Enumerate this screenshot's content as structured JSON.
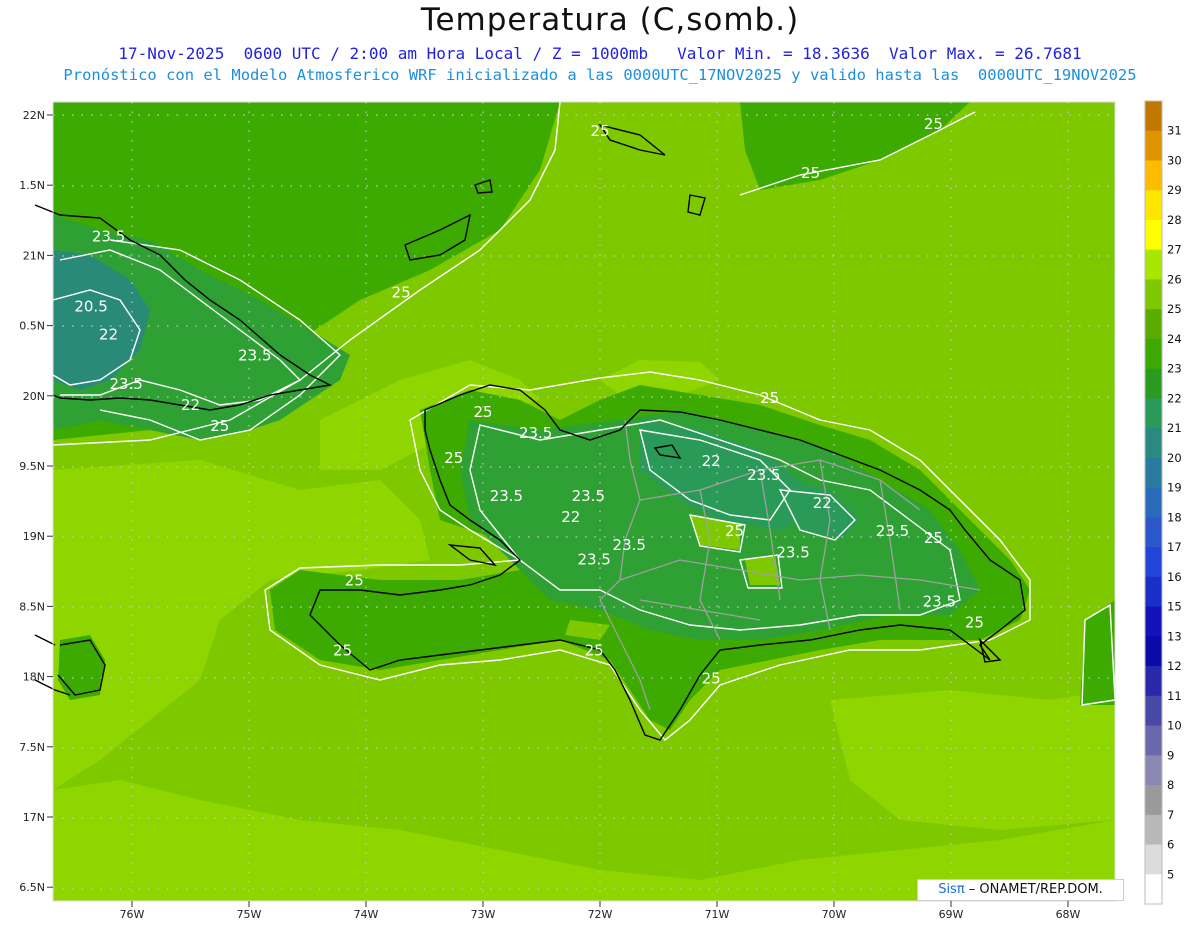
{
  "title": "Temperatura (C,somb.)",
  "subtitle_line1": "17-Nov-2025  0600 UTC / 2:00 am Hora Local / Z = 1000mb   Valor Min. = 18.3636  Valor Max. = 26.7681",
  "subtitle_line2": "Pronóstico con el Modelo Atmosferico WRF inicializado a las 0000UTC_17NOV2025 y valido hasta las  0000UTC_19NOV2025",
  "credit": {
    "brand": "Sisπ",
    "text": " – ONAMET/REP.DOM."
  },
  "axes": {
    "lat_ticks": [
      "22N",
      "1.5N",
      "21N",
      "0.5N",
      "20N",
      "9.5N",
      "19N",
      "8.5N",
      "18N",
      "7.5N",
      "17N",
      "6.5N"
    ],
    "lon_ticks": [
      "76W",
      "75W",
      "74W",
      "73W",
      "72W",
      "71W",
      "70W",
      "69W",
      "68W"
    ]
  },
  "colorbar": {
    "labels": [
      "31",
      "30",
      "29",
      "28",
      "27",
      "26",
      "25",
      "24",
      "23",
      "22",
      "21",
      "20",
      "19",
      "18",
      "17",
      "16",
      "15",
      "13",
      "12",
      "11",
      "10",
      "9",
      "8",
      "7",
      "6",
      "5"
    ],
    "colors": [
      "#c07800",
      "#e09400",
      "#ffbb00",
      "#ffe600",
      "#ffff00",
      "#a8e600",
      "#7dc800",
      "#5aac00",
      "#3ca800",
      "#2a9a20",
      "#2a9a58",
      "#2a8a80",
      "#2a7aa0",
      "#2a6ab8",
      "#2a58cc",
      "#2244d8",
      "#1a2ec8",
      "#1212b8",
      "#0a0aa8",
      "#2828a8",
      "#4848a8",
      "#6868aa",
      "#8a88b0",
      "#9a9a9a",
      "#b8b8b8",
      "#dcdcdc",
      "#ffffff"
    ]
  },
  "contour_labels": [
    {
      "t": "25",
      "lon": -72.0,
      "lat": 21.85
    },
    {
      "t": "25",
      "lon": -69.15,
      "lat": 21.9
    },
    {
      "t": "25",
      "lon": -70.2,
      "lat": 21.55
    },
    {
      "t": "23.5",
      "lon": -76.2,
      "lat": 21.1
    },
    {
      "t": "25",
      "lon": -73.7,
      "lat": 20.7
    },
    {
      "t": "20.5",
      "lon": -76.35,
      "lat": 20.6
    },
    {
      "t": "22",
      "lon": -76.2,
      "lat": 20.4
    },
    {
      "t": "23.5",
      "lon": -74.95,
      "lat": 20.25
    },
    {
      "t": "23.5",
      "lon": -76.05,
      "lat": 20.05
    },
    {
      "t": "22",
      "lon": -75.5,
      "lat": 19.9
    },
    {
      "t": "25",
      "lon": -75.25,
      "lat": 19.75
    },
    {
      "t": "25",
      "lon": -70.55,
      "lat": 19.95
    },
    {
      "t": "25",
      "lon": -73.0,
      "lat": 19.85
    },
    {
      "t": "23.5",
      "lon": -72.55,
      "lat": 19.7
    },
    {
      "t": "25",
      "lon": -73.25,
      "lat": 19.52
    },
    {
      "t": "22",
      "lon": -71.05,
      "lat": 19.5
    },
    {
      "t": "23.5",
      "lon": -70.6,
      "lat": 19.4
    },
    {
      "t": "23.5",
      "lon": -72.8,
      "lat": 19.25
    },
    {
      "t": "23.5",
      "lon": -72.1,
      "lat": 19.25
    },
    {
      "t": "22",
      "lon": -70.1,
      "lat": 19.2
    },
    {
      "t": "22",
      "lon": -72.25,
      "lat": 19.1
    },
    {
      "t": "25",
      "lon": -70.85,
      "lat": 19.0
    },
    {
      "t": "23.5",
      "lon": -69.5,
      "lat": 19.0
    },
    {
      "t": "25",
      "lon": -69.15,
      "lat": 18.95
    },
    {
      "t": "23.5",
      "lon": -71.75,
      "lat": 18.9
    },
    {
      "t": "23.5",
      "lon": -72.05,
      "lat": 18.8
    },
    {
      "t": "23.5",
      "lon": -70.35,
      "lat": 18.85
    },
    {
      "t": "25",
      "lon": -74.1,
      "lat": 18.65
    },
    {
      "t": "23.5",
      "lon": -69.1,
      "lat": 18.5
    },
    {
      "t": "25",
      "lon": -68.8,
      "lat": 18.35
    },
    {
      "t": "25",
      "lon": -74.2,
      "lat": 18.15
    },
    {
      "t": "25",
      "lon": -72.05,
      "lat": 18.15
    },
    {
      "t": "25",
      "lon": -71.05,
      "lat": 17.95
    }
  ]
}
